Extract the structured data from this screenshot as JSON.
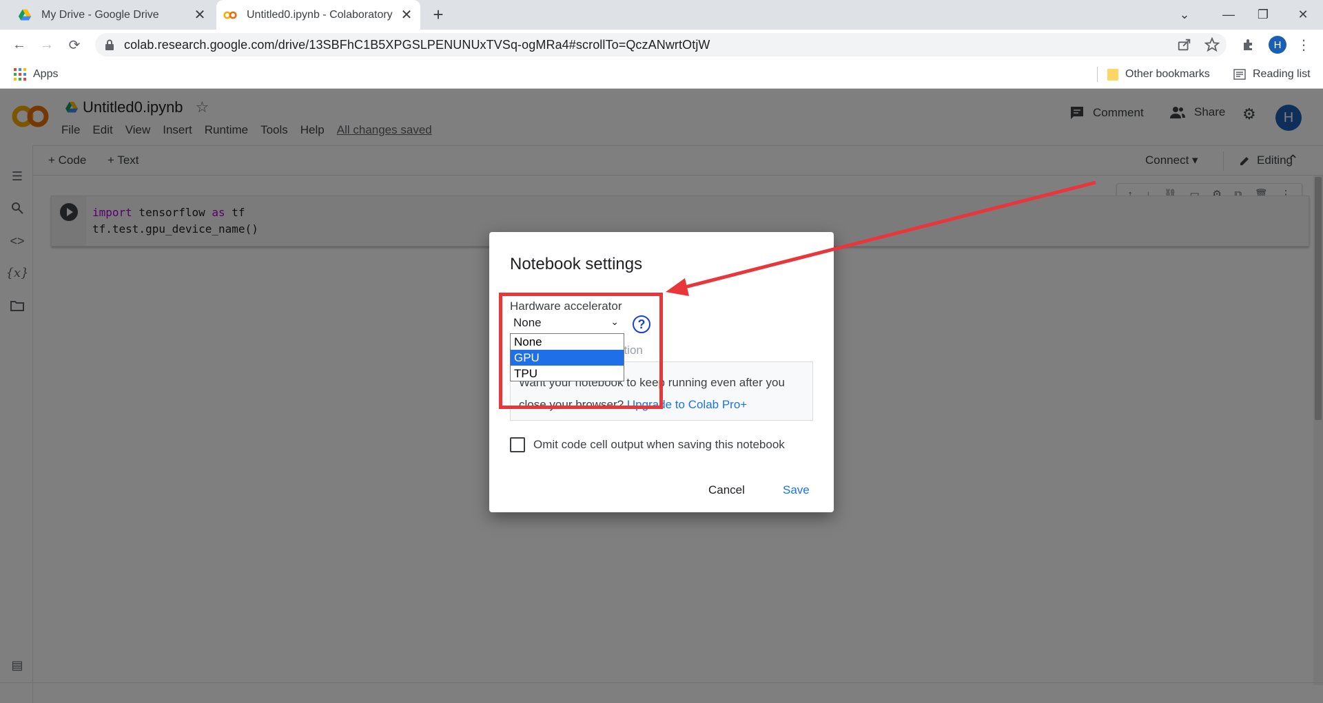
{
  "browser": {
    "tabs": [
      {
        "title": "My Drive - Google Drive",
        "icon": "google-drive-icon",
        "active": false
      },
      {
        "title": "Untitled0.ipynb - Colaboratory",
        "icon": "colab-icon",
        "active": true
      }
    ],
    "url": "colab.research.google.com/drive/13SBFhC1B5XPGSLPENUNUxTVSq-ogMRa4#scrollTo=QczANwrtOtjW",
    "profile_initial": "H",
    "bookmarks": {
      "apps": "Apps",
      "other": "Other bookmarks",
      "reading_list": "Reading list"
    }
  },
  "colab": {
    "logo": "CO",
    "notebook_title": "Untitled0.ipynb",
    "menu": [
      "File",
      "Edit",
      "View",
      "Insert",
      "Runtime",
      "Tools",
      "Help"
    ],
    "save_status": "All changes saved",
    "comment": "Comment",
    "share": "Share",
    "avatar_initial": "H",
    "toolbar": {
      "add_code": "+ Code",
      "add_text": "+ Text",
      "connect": "Connect",
      "editing": "Editing"
    },
    "cell": {
      "line1": {
        "kw1": "import",
        "mid": " tensorflow ",
        "kw2": "as",
        "end": " tf"
      },
      "line2": "tf.test.gpu_device_name()"
    }
  },
  "dialog": {
    "title": "Notebook settings",
    "hardware_label": "Hardware accelerator",
    "selected_value": "None",
    "options": [
      "None",
      "GPU",
      "TPU"
    ],
    "highlighted_option": "GPU",
    "hidden_hint_fragment": "ution",
    "info_text": "Want your notebook to keep running even after you close your browser?",
    "info_link": "Upgrade to Colab Pro+",
    "omit_output_label": "Omit code cell output when saving this notebook",
    "omit_output_checked": false,
    "cancel": "Cancel",
    "save": "Save"
  },
  "colors": {
    "annotation_red": "#e8363b",
    "selection_blue": "#1e6fe8",
    "link_blue": "#1a73e8",
    "colab_orange": "#f9ab00"
  }
}
